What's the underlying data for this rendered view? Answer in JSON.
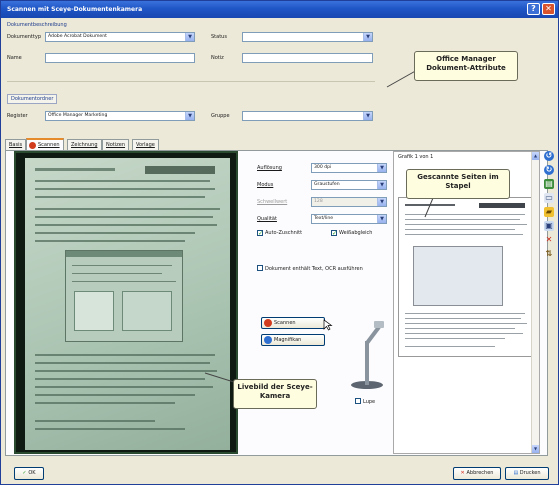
{
  "window": {
    "title": "Scannen mit Sceye-Dokumentenkamera",
    "help_glyph": "?",
    "close_glyph": "✕"
  },
  "doc_description": {
    "group_label": "Dokumentbeschreibung",
    "doctype_label": "Dokumenttyp",
    "doctype_value": "Adobe Acrobat Dokument",
    "status_label": "Status",
    "status_value": "",
    "name_label": "Name",
    "name_value": "",
    "note_label": "Notiz",
    "note_value": ""
  },
  "doc_location": {
    "group_label": "Dokumentordner",
    "register_label": "Register",
    "register_value": "Office Manager Marketing",
    "group_field_label": "Gruppe",
    "group_field_value": ""
  },
  "callouts": {
    "attributes": "Office Manager Dokument-Attribute",
    "pages": "Gescannte Seiten im Stapel",
    "live": "Livebild der Sceye-Kamera"
  },
  "tabs": [
    {
      "label": "Basis"
    },
    {
      "label": "Scannen"
    },
    {
      "label": "Zeichnung"
    },
    {
      "label": "Notizen"
    },
    {
      "label": "Vorlage"
    }
  ],
  "scan_settings": {
    "resolution_label": "Auflösung",
    "resolution_value": "300 dpi",
    "mode_label": "Modus",
    "mode_value": "Graustufen",
    "threshold_label": "Schwellwert",
    "threshold_value": "128",
    "quality_label": "Qualität",
    "quality_value": "Text/line",
    "autozoom_label": "Auto-Zuschnitt",
    "autozoom_checked": true,
    "white_label": "Weißabgleich",
    "white_checked": true,
    "ocr_label": "Dokument enthält Text, OCR ausführen",
    "ocr_checked": false,
    "scan_button": "Scannen",
    "wizard_button": "Magnifikan",
    "lupe_label": "Lupe",
    "lupe_checked": false
  },
  "preview": {
    "header": "Grafik 1 von 1"
  },
  "footer": {
    "ok_button": "OK",
    "cancel_button": "Abbrechen",
    "print_button": "Drucken"
  }
}
